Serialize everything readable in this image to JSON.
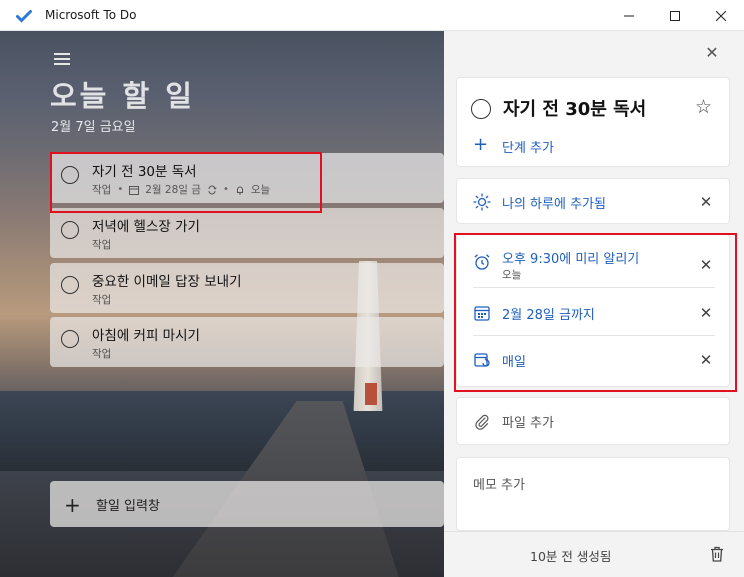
{
  "window": {
    "title": "Microsoft To Do",
    "minimize": "—",
    "maximize": "☐",
    "close": "✕"
  },
  "list": {
    "title": "오늘 할 일",
    "date": "2월 7일 금요일"
  },
  "tasks": [
    {
      "name": "자기 전 30분 독서",
      "category": "작업",
      "due": "2월 28일 금",
      "reminder": "오늘"
    },
    {
      "name": "저녁에 헬스장 가기",
      "category": "작업"
    },
    {
      "name": "중요한 이메일 답장 보내기",
      "category": "작업"
    },
    {
      "name": "아침에 커피 마시기",
      "category": "작업"
    }
  ],
  "add_task": {
    "plus": "+",
    "label": "할일 입력창"
  },
  "detail": {
    "close": "✕",
    "title": "자기 전 30분 독서",
    "star": "☆",
    "add_step_plus": "+",
    "add_step": "단계 추가",
    "my_day": "나의 하루에 추가됨",
    "reminder": "오후 9:30에 미리 알리기",
    "reminder_sub": "오늘",
    "due": "2월 28일 금까지",
    "repeat": "매일",
    "remove": "✕",
    "add_file": "파일 추가",
    "note": "메모 추가",
    "created": "10분 전 생성됨"
  },
  "colors": {
    "accent": "#1f5fbf",
    "highlight": "#e0101e"
  }
}
